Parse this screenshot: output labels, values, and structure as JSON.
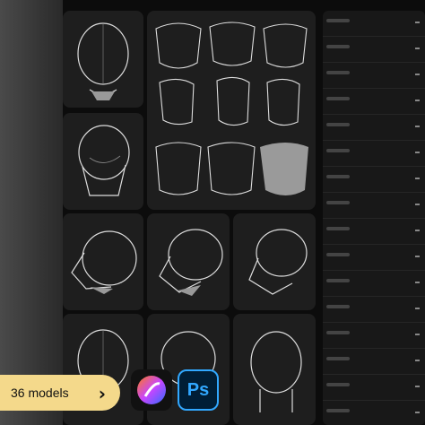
{
  "badge": {
    "label": "36 models",
    "arrow": "›"
  },
  "apps": [
    {
      "name": "procreate",
      "icon": "procreate-icon"
    },
    {
      "name": "photoshop",
      "label": "Ps",
      "icon": "photoshop-icon"
    }
  ],
  "colors": {
    "badge": "#f4d98b",
    "card": "#1e1e1e",
    "ps_accent": "#31a8ff"
  }
}
